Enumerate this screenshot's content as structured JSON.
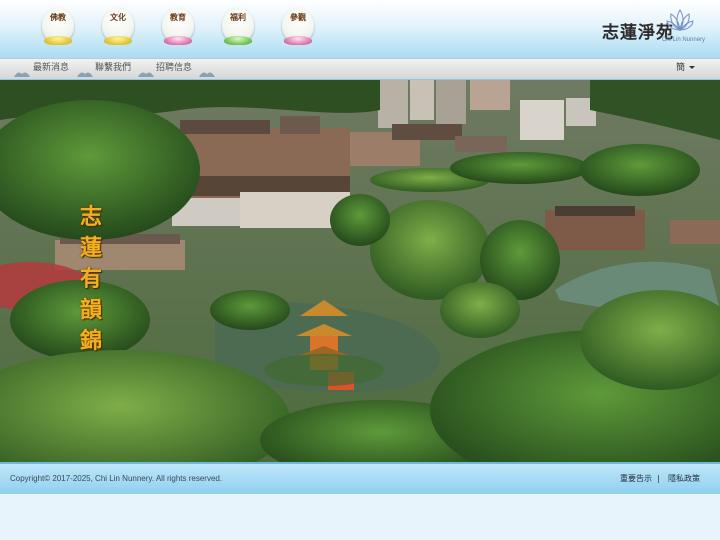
{
  "nav_icons": [
    {
      "label": "佛教",
      "icon": "lotus-yellow-icon"
    },
    {
      "label": "文化",
      "icon": "lotus-yellow-icon"
    },
    {
      "label": "教育",
      "icon": "lotus-pink-icon"
    },
    {
      "label": "福利",
      "icon": "lotus-green-icon"
    },
    {
      "label": "參觀",
      "icon": "lotus-pink-icon"
    }
  ],
  "logo": {
    "chinese": "志蓮淨苑",
    "english": "Chi Lin Nunnery",
    "icon": "lotus-logo-icon"
  },
  "menu": {
    "items": [
      "最新消息",
      "聯繫我們",
      "招聘信息"
    ]
  },
  "language": {
    "current": "簡"
  },
  "hero": {
    "title_chars": [
      "志",
      "蓮",
      "有",
      "韻",
      "錦"
    ]
  },
  "footer": {
    "copyright": "Copyright© 2017-2025, Chi Lin Nunnery. All rights reserved.",
    "notice_link": "重要告示",
    "separator": "|",
    "privacy_link": "隱私政策"
  },
  "colors": {
    "header_blue": "#a9dcf3",
    "footer_blue": "#8fd0ef",
    "title_gold": "#f0b021"
  }
}
